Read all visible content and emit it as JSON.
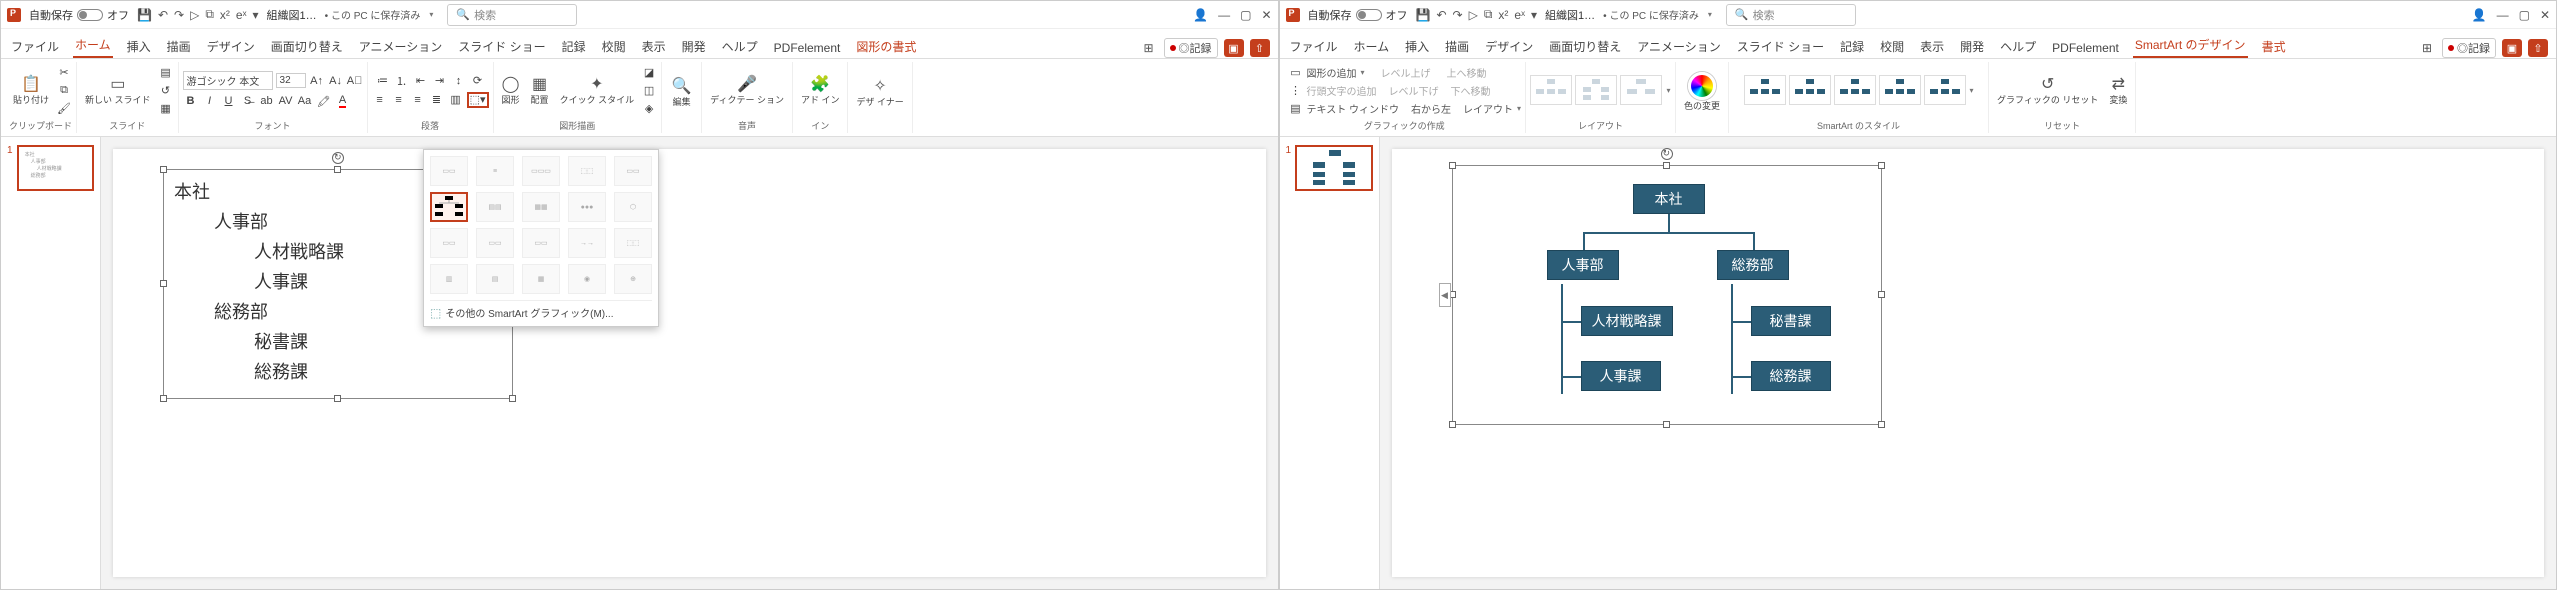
{
  "shared": {
    "autosave_label": "自動保存",
    "autosave_state": "オフ",
    "doc_title": "組織図1…",
    "saved_state": "• この PC に保存済み",
    "search_placeholder": "検索",
    "qat": {
      "save": "💾",
      "undo": "↶",
      "redo": "↷",
      "slideshow": "▷",
      "show": "⧉",
      "x2": "x²",
      "ex": "eˣ",
      "drop": "▾"
    },
    "win": {
      "user": "👤",
      "min": "—",
      "max": "▢",
      "close": "✕"
    },
    "rec_label": "◎記録",
    "share_icon": "⇧"
  },
  "left": {
    "tabs": [
      "ファイル",
      "ホーム",
      "挿入",
      "描画",
      "デザイン",
      "画面切り替え",
      "アニメーション",
      "スライド ショー",
      "記録",
      "校閲",
      "表示",
      "開発",
      "ヘルプ",
      "PDFelement",
      "図形の書式"
    ],
    "active_tab": "ホーム",
    "shape_tab": "図形の書式",
    "ribbon_groups": {
      "clipboard": "クリップボード",
      "paste": "貼り付け",
      "slides": "スライド",
      "new_slide": "新しい\nスライド",
      "font": "フォント",
      "font_family": "游ゴシック 本文",
      "font_size": "32",
      "paragraph": "段落",
      "drawing": "図形描画",
      "shapes": "図形",
      "arrange": "配置",
      "quick_style": "クイック\nスタイル",
      "editing": "編集",
      "dictation": "ディクテー\nション",
      "dict_grp": "音声",
      "addins": "アド\nイン",
      "addins_grp": "イン",
      "designer": "デザ\nイナー"
    },
    "text_lines": [
      "本社",
      "人事部",
      "人材戦略課",
      "人事課",
      "総務部",
      "秘書課",
      "総務課"
    ],
    "gallery_footer": "その他の SmartArt グラフィック(M)..."
  },
  "right": {
    "tabs": [
      "ファイル",
      "ホーム",
      "挿入",
      "描画",
      "デザイン",
      "画面切り替え",
      "アニメーション",
      "スライド ショー",
      "記録",
      "校閲",
      "表示",
      "開発",
      "ヘルプ",
      "PDFelement",
      "SmartArt のデザイン",
      "書式"
    ],
    "active_tab": "SmartArt のデザイン",
    "format_tab": "書式",
    "ribbon_groups": {
      "create": "グラフィックの作成",
      "add_shape": "図形の追加",
      "add_bullet": "行頭文字の追加",
      "text_pane": "テキスト ウィンドウ",
      "lvl_up": "レベル上げ",
      "lvl_down": "レベル下げ",
      "move_up": "上へ移動",
      "move_down": "下へ移動",
      "rtl": "右から左",
      "layout_btn": "レイアウト",
      "layout": "レイアウト",
      "color_change": "色の変更",
      "styles": "SmartArt のスタイル",
      "reset": "グラフィックの\nリセット",
      "reset_grp": "リセット",
      "convert": "変換"
    },
    "nodes": {
      "root": "本社",
      "l1a": "人事部",
      "l1b": "総務部",
      "l2a": "人材戦略課",
      "l2b": "秘書課",
      "l2c": "人事課",
      "l2d": "総務課"
    }
  }
}
